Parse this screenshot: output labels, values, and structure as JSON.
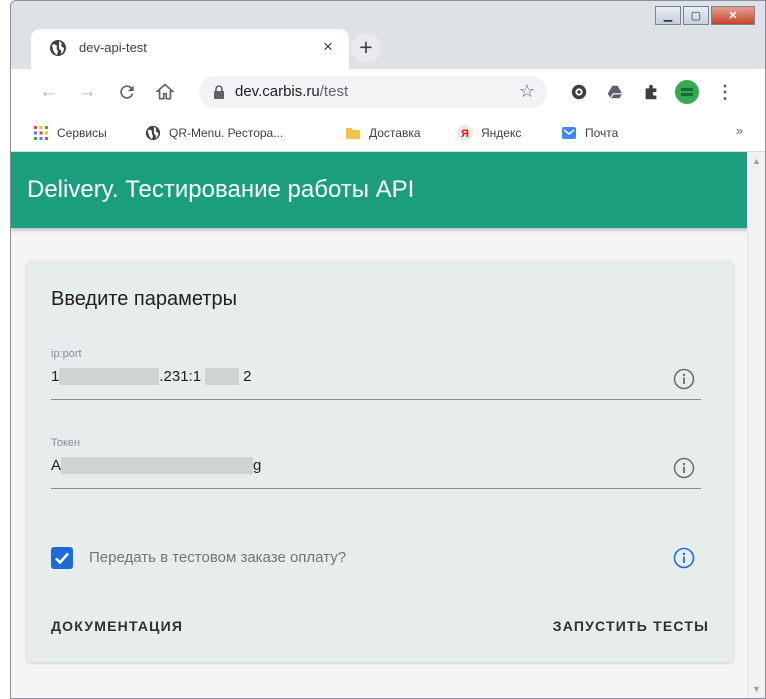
{
  "browser": {
    "tab_title": "dev-api-test",
    "tab_close": "×",
    "new_tab": "+",
    "url_host": "dev.carbis.ru",
    "url_path": "/test",
    "bookmarks": [
      {
        "label": "Сервисы",
        "icon": "apps-grid-icon"
      },
      {
        "label": "QR-Menu. Рестора...",
        "icon": "globe-icon"
      },
      {
        "label": "Доставка",
        "icon": "folder-icon"
      },
      {
        "label": "Яндекс",
        "icon": "yandex-icon"
      },
      {
        "label": "Почта",
        "icon": "mail-icon"
      }
    ],
    "bookmarks_more": "»"
  },
  "page": {
    "appbar_title": "Delivery. Тестирование работы API",
    "form_title": "Введите параметры",
    "fields": [
      {
        "label": "ip:port",
        "value_start": "1",
        "value_mid": ".231:1",
        "value_end": "2"
      },
      {
        "label": "Токен",
        "value_start": "A",
        "value_end": "g"
      }
    ],
    "checkbox_label": "Передать в тестовом заказе оплату?",
    "checkbox_checked": true,
    "docs_button": "ДОКУМЕНТАЦИЯ",
    "run_button": "ЗАПУСТИТЬ ТЕСТЫ"
  },
  "colors": {
    "appbar": "#1b9e7e",
    "checkbox": "#1e6ad6",
    "info_active": "#1e6ad6"
  }
}
